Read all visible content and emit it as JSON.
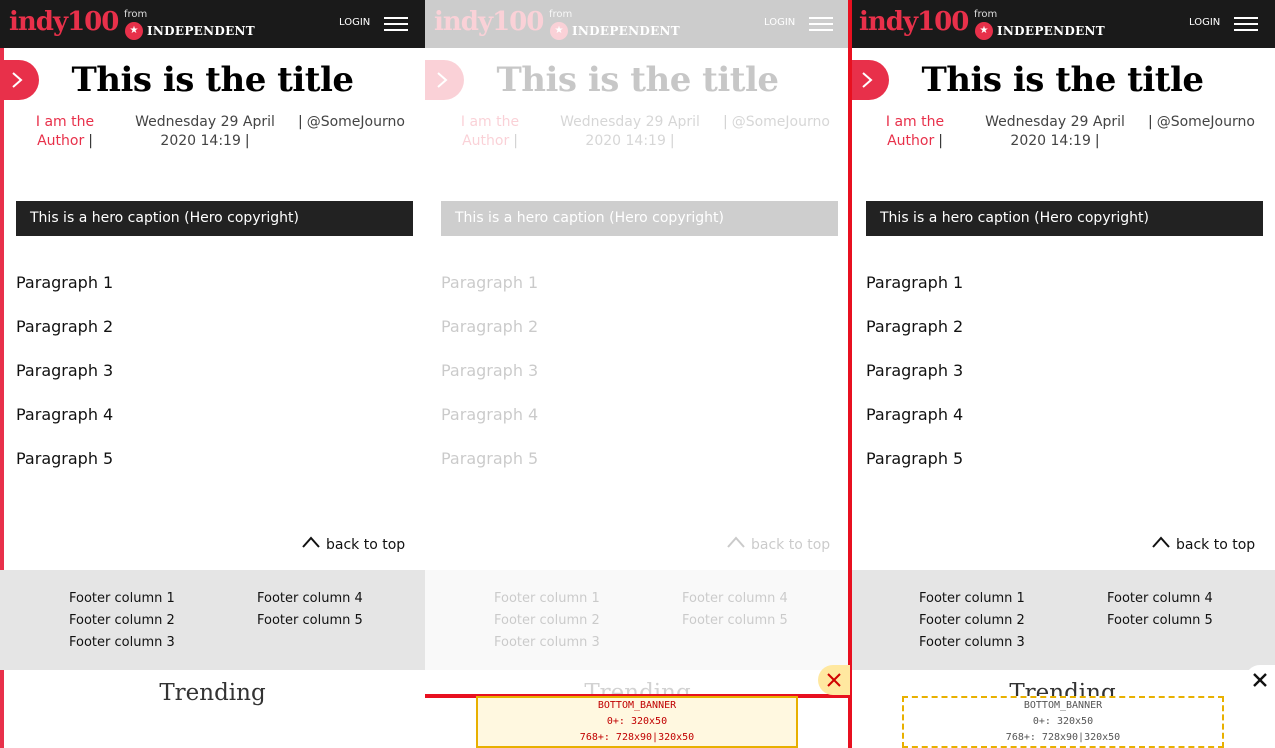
{
  "header": {
    "logo": "indy100",
    "from_label": "from",
    "independent_label": "INDEPENDENT",
    "login_label": "LOGIN"
  },
  "article": {
    "title": "This is the title",
    "author": "I am the Author",
    "date": "Wednesday 29 April 2020 14:19",
    "handle": "@SomeJourno",
    "hero_caption": "This is a hero caption (Hero copyright)",
    "paragraphs": [
      "Paragraph 1",
      "Paragraph 2",
      "Paragraph 3",
      "Paragraph 4",
      "Paragraph 5"
    ],
    "back_to_top": "back to top"
  },
  "footer": {
    "columns": [
      "Footer column 1",
      "Footer column 2",
      "Footer column 3",
      "Footer column 4",
      "Footer column 5"
    ]
  },
  "trending_label": "Trending",
  "banners": {
    "middle": {
      "line1": "BOTTOM_BANNER",
      "line2": "0+: 320x50",
      "line3": "768+: 728x90|320x50"
    },
    "right": {
      "line1": "BOTTOM_BANNER",
      "line2": "0+: 320x50",
      "line3": "768+: 728x90|320x50"
    }
  },
  "colors": {
    "accent": "#e8304a",
    "header_bg": "#1a1a1a",
    "footer_bg": "#e5e5e5"
  }
}
